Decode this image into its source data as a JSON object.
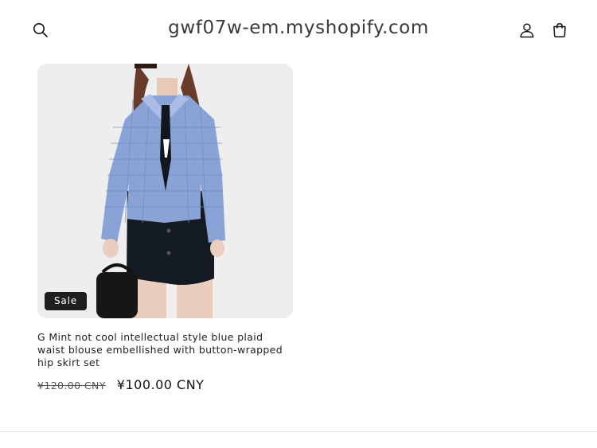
{
  "header": {
    "site_title": "gwf07w-em.myshopify.com",
    "icons": [
      "search-icon",
      "account-icon",
      "cart-icon"
    ]
  },
  "product": {
    "badge": "Sale",
    "title": "G Mint not cool intellectual style blue plaid waist blouse embellished with button-wrapped hip skirt set",
    "price_original": "¥120.00 CNY",
    "price_sale": "¥100.00 CNY"
  },
  "colors": {
    "text": "#121212",
    "badge_bg": "#1e1e1e",
    "image_bg": "#eeeeef"
  }
}
